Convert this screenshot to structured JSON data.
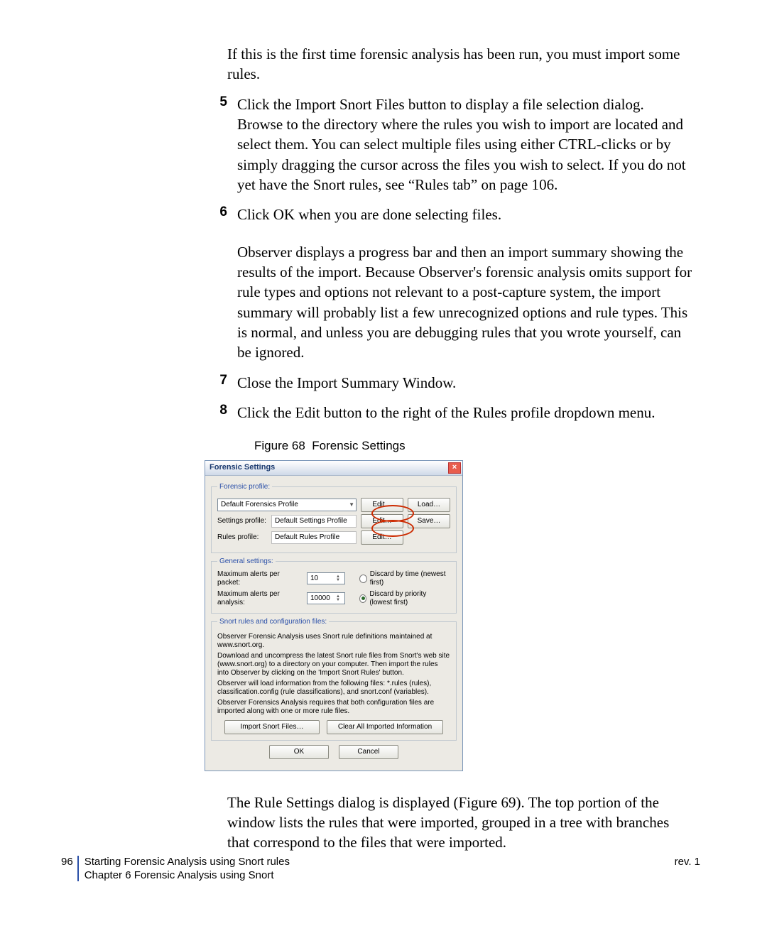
{
  "body": {
    "intro": "If this is the first time forensic analysis has been run, you must import some rules.",
    "step5_num": "5",
    "step5": "Click the Import Snort Files button to display a file selection dialog. Browse to the directory where the rules you wish to import are located and select them. You can select multiple files using either CTRL-clicks or by simply dragging the cursor across the files you wish to select. If you do not yet have the Snort rules, see “Rules tab” on page 106.",
    "step6_num": "6",
    "step6_a": "Click OK when you are done selecting files.",
    "step6_b": "Observer displays a progress bar and then an import summary showing the results of the import. Because Observer's forensic analysis omits support for rule types and options not relevant to a post-capture system, the import summary will probably list a few unrecognized options and rule types. This is normal, and unless you are debugging rules that you wrote yourself, can be ignored.",
    "step7_num": "7",
    "step7": "Close the Import Summary Window.",
    "step8_num": "8",
    "step8": "Click the Edit button to the right of the Rules profile dropdown menu.",
    "fig_caption": "Figure 68  Forensic Settings",
    "post_fig": "The Rule Settings dialog is displayed (Figure 69). The top portion of the window lists the rules that were imported, grouped in a tree with branches that correspond to the files that were imported."
  },
  "dialog": {
    "title": "Forensic Settings",
    "close": "×",
    "fp_legend": "Forensic profile:",
    "fp_combo": "Default Forensics Profile",
    "edit": "Edit…",
    "load": "Load…",
    "save": "Save…",
    "settings_label": "Settings profile:",
    "settings_value": "Default Settings Profile",
    "rules_label": "Rules profile:",
    "rules_value": "Default Rules Profile",
    "gs_legend": "General settings:",
    "max_packet_label": "Maximum alerts per packet:",
    "max_packet_value": "10",
    "max_analysis_label": "Maximum alerts per analysis:",
    "max_analysis_value": "10000",
    "radio_time": "Discard by time (newest first)",
    "radio_prio": "Discard by priority (lowest first)",
    "snort_legend": "Snort rules and configuration files:",
    "snort_p1": "Observer Forensic Analysis uses Snort rule definitions maintained at www.snort.org.",
    "snort_p2": "Download and uncompress the latest Snort rule files from Snort's web site (www.snort.org) to a directory on your computer. Then import the rules into Observer by clicking on the 'Import Snort Rules' button.",
    "snort_p3": "Observer will load information from the following files: *.rules (rules), classification.config (rule classifications), and snort.conf (variables).",
    "snort_p4": "Observer Forensics Analysis requires that both configuration files are imported along with one or more rule files.",
    "import_btn": "Import Snort Files…",
    "clear_btn": "Clear All Imported Information",
    "ok": "OK",
    "cancel": "Cancel"
  },
  "footer": {
    "page": "96",
    "line1": "Starting Forensic Analysis using Snort rules",
    "line2": "Chapter 6 Forensic Analysis using Snort",
    "rev": "rev. 1"
  }
}
